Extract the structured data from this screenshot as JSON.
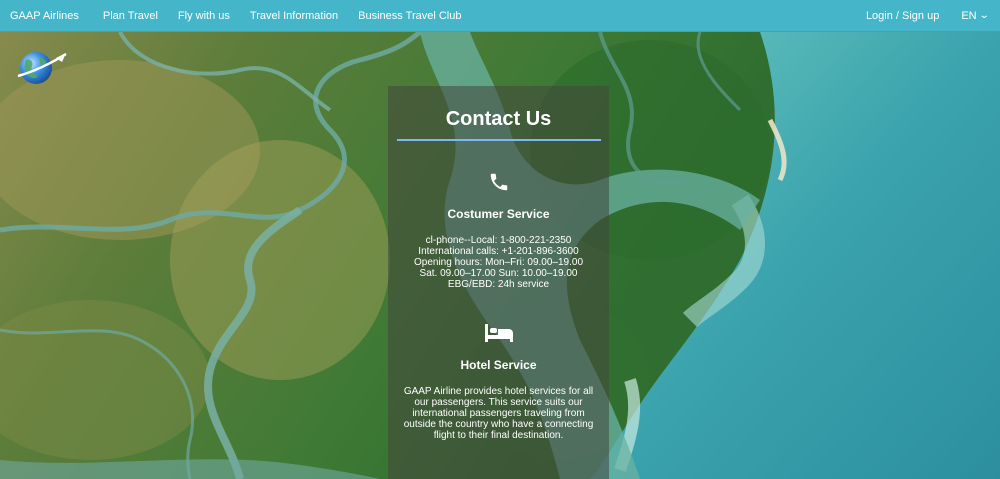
{
  "navbar": {
    "brand": "GAAP Airlines",
    "items": [
      {
        "label": "Plan Travel"
      },
      {
        "label": "Fly with us"
      },
      {
        "label": "Travel Information"
      },
      {
        "label": "Business Travel Club"
      }
    ],
    "login_label": "Login / Sign up",
    "language": "EN"
  },
  "contact": {
    "title": "Contact Us",
    "customer_service": {
      "title": "Costumer Service",
      "lines": [
        "cl-phone--Local: 1-800-221-2350",
        "International calls: +1-201-896-3600",
        "Opening hours: Mon–Fri: 09.00–19.00",
        "Sat. 09.00–17.00 Sun: 10.00–19.00",
        "EBG/EBD: 24h service"
      ]
    },
    "hotel_service": {
      "title": "Hotel Service",
      "description": "GAAP Airline provides hotel services for all our passengers. This service suits our international passengers traveling from outside the country who have a connecting flight to their final destination."
    }
  },
  "colors": {
    "navbar_bg": "#45b6c9",
    "title_rule": "#7fb8f0",
    "panel_bg": "rgba(70,70,60,0.55)"
  },
  "icons": {
    "logo": "globe-airplane-logo",
    "customer_service": "phone-icon",
    "hotel_service": "bed-icon",
    "language_dropdown": "chevron-down-icon"
  }
}
